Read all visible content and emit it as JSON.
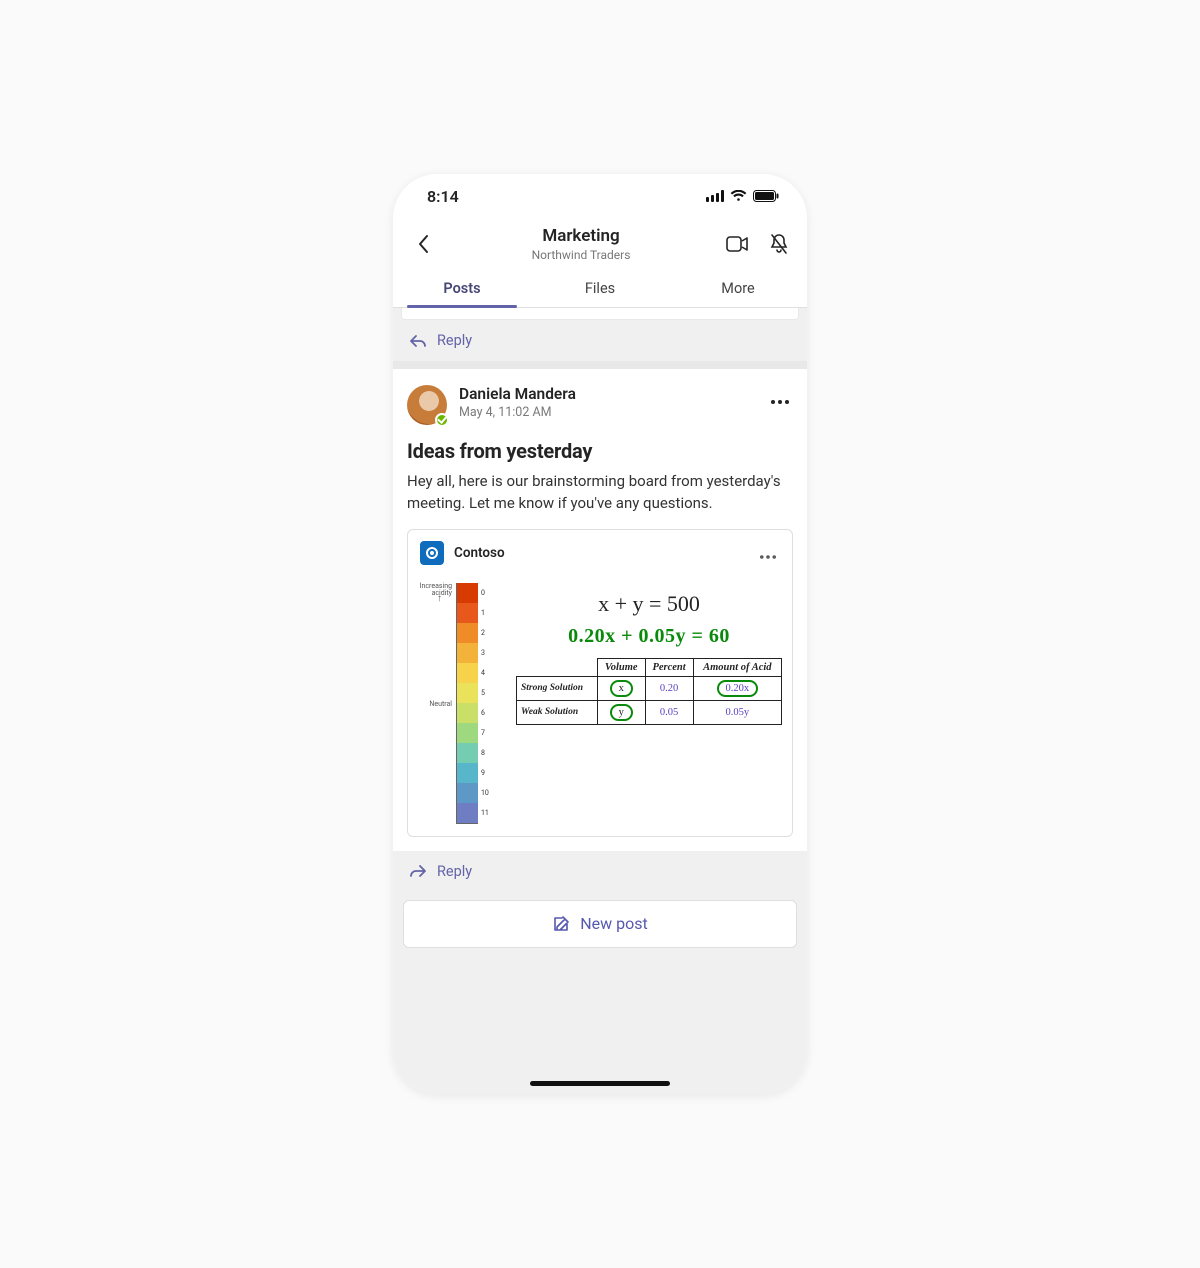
{
  "status": {
    "time": "8:14"
  },
  "header": {
    "title": "Marketing",
    "subtitle": "Northwind Traders",
    "tabs": [
      "Posts",
      "Files",
      "More"
    ],
    "active_tab": 0
  },
  "reply_label": "Reply",
  "post": {
    "author": "Daniela Mandera",
    "timestamp": "May 4, 11:02 AM",
    "title": "Ideas from yesterday",
    "body": "Hey all, here is our brainstorming board from yesterday's meeting. Let me know if you've any questions."
  },
  "attachment": {
    "app_name": "Contoso",
    "scale_labels": {
      "increasing": "Increasing\nacidity",
      "neutral": "Neutral"
    },
    "scale_ticks": [
      "0",
      "1",
      "2",
      "3",
      "4",
      "5",
      "6",
      "7",
      "8",
      "9",
      "10",
      "11"
    ],
    "scale_colors": [
      "#d83b01",
      "#e8571b",
      "#f08c28",
      "#f3b33b",
      "#f6d34a",
      "#e9e25a",
      "#c9df68",
      "#9fd97f",
      "#74cdb0",
      "#57b6c9",
      "#5e98c7",
      "#6f7dc2"
    ],
    "eq1": "x + y = 500",
    "eq2": "0.20x + 0.05y = 60",
    "table": {
      "headers": [
        "Volume",
        "Percent",
        "Amount of Acid"
      ],
      "rows": [
        {
          "label": "Strong Solution",
          "cells": [
            "x",
            "0.20",
            "0.20x"
          ],
          "ring": [
            true,
            false,
            true
          ]
        },
        {
          "label": "Weak Solution",
          "cells": [
            "y",
            "0.05",
            "0.05y"
          ],
          "ring": [
            true,
            false,
            false
          ]
        }
      ]
    }
  },
  "newpost_label": "New post"
}
